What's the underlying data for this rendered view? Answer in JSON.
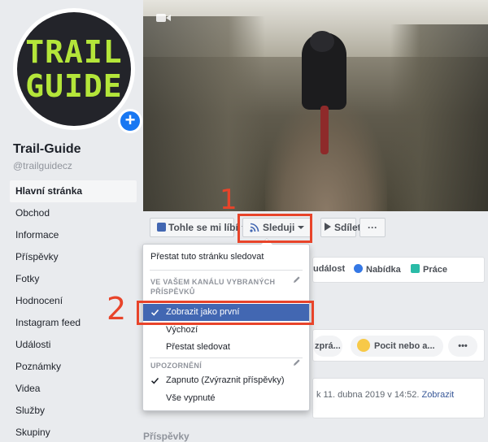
{
  "page": {
    "name": "Trail-Guide",
    "handle": "@trailguidecz",
    "logo_lines": [
      "TRAIL",
      "GUIDE"
    ],
    "badge": "+"
  },
  "sidebar": {
    "items": [
      {
        "label": "Hlavní stránka",
        "active": true
      },
      {
        "label": "Obchod"
      },
      {
        "label": "Informace"
      },
      {
        "label": "Příspěvky"
      },
      {
        "label": "Fotky"
      },
      {
        "label": "Hodnocení"
      },
      {
        "label": "Instagram feed"
      },
      {
        "label": "Události"
      },
      {
        "label": "Poznámky"
      },
      {
        "label": "Videa"
      },
      {
        "label": "Služby"
      },
      {
        "label": "Skupiny"
      }
    ]
  },
  "actions": {
    "like_label": "Tohle se mi líbí",
    "follow_label": "Sleduji",
    "share_label": "Sdílet",
    "more_label": "···"
  },
  "dropdown": {
    "unfollow_label": "Přestat tuto stránku sledovat",
    "section_feed": "VE VAŠEM KANÁLU VYBRANÝCH PŘÍSPĚVKŮ",
    "show_first": "Zobrazit jako první",
    "default": "Výchozí",
    "stop_following": "Přestat sledovat",
    "section_notifications": "UPOZORNĚNÍ",
    "on_label": "Zapnuto (Zvýraznit příspěvky)",
    "all_off": "Vše vypnuté"
  },
  "main": {
    "tabs": [
      "událost",
      "Nabídka",
      "Práce"
    ],
    "compose_pills": [
      "zprá...",
      "Pocit nebo a...",
      "•••"
    ],
    "about_text": "k 11. dubna 2019 v 14:52.",
    "about_link": "Zobrazit",
    "posts_heading": "Příspěvky"
  },
  "annotations": {
    "step1": "1",
    "step2": "2"
  },
  "colors": {
    "accent": "#4267b2",
    "annotation": "#e8442a",
    "logo_green": "#b4e63a"
  }
}
